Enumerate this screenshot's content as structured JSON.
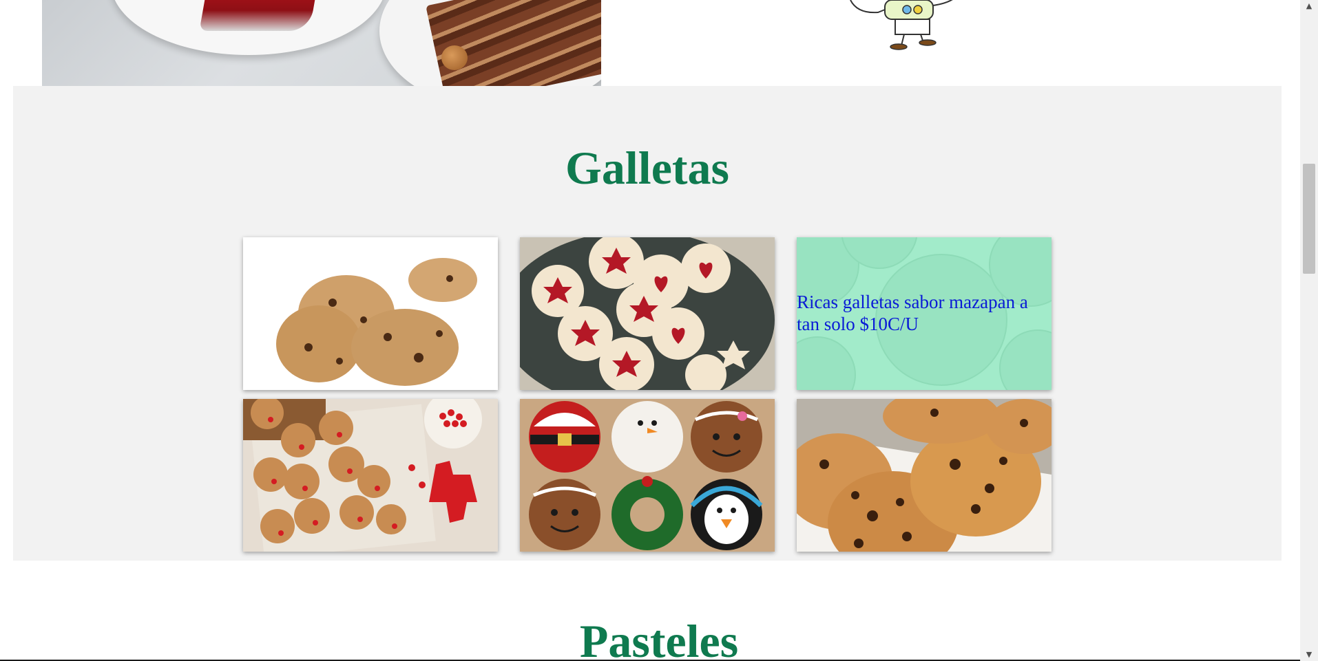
{
  "sections": {
    "galletas": {
      "title": "Galletas",
      "cards": [
        {
          "image": "chocolate-chip-cookies-white-background",
          "caption": ""
        },
        {
          "image": "jam-star-heart-linzer-cookies",
          "caption": ""
        },
        {
          "image": "cookie-hover-overlay",
          "caption": "Ricas galletas sabor mazapan a tan solo $10C/U"
        },
        {
          "image": "reindeer-christmas-cookies",
          "caption": ""
        },
        {
          "image": "decorated-christmas-character-cookies",
          "caption": ""
        },
        {
          "image": "chocolate-chip-cookies-plate",
          "caption": ""
        }
      ]
    },
    "pasteles": {
      "title": "Pasteles"
    }
  },
  "colors": {
    "title_green": "#0f7a4f",
    "caption_blue": "#0a1bd6",
    "section_bg": "#f2f2f2",
    "overlay_mint": "#8fe3c0"
  }
}
